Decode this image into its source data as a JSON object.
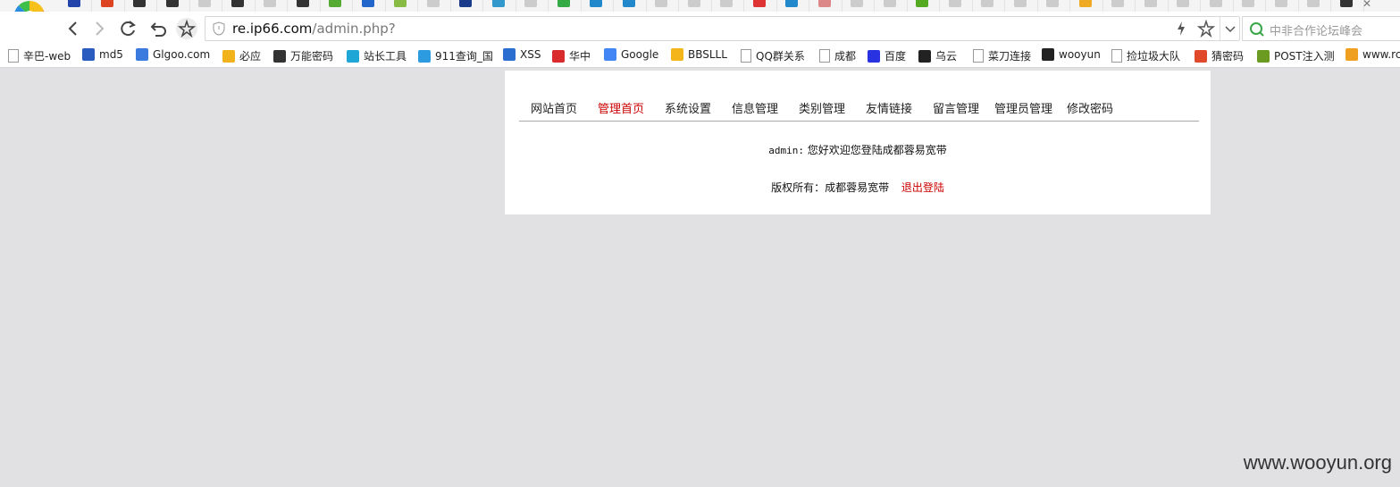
{
  "browser": {
    "url_host": "re.ip66.com",
    "url_path": "/admin.php?",
    "search_placeholder": "中非合作论坛峰会",
    "tab_icon_colors": [
      "#2244aa",
      "#dd4422",
      "#333333",
      "#333333",
      "#cccccc",
      "#333333",
      "#cccccc",
      "#333333",
      "#55aa33",
      "#2266cc",
      "#88bb44",
      "#cccccc",
      "#1a3a8a",
      "#3399cc",
      "#cccccc",
      "#33aa44",
      "#2288cc",
      "#2288cc",
      "#cccccc",
      "#cccccc",
      "#cccccc",
      "#dd3333",
      "#2288cc",
      "#dd8888",
      "#cccccc",
      "#cccccc",
      "#55aa22",
      "#cccccc",
      "#cccccc",
      "#cccccc",
      "#cccccc",
      "#eeaa22",
      "#cccccc",
      "#cccccc",
      "#cccccc",
      "#cccccc",
      "#cccccc",
      "#cccccc",
      "#cccccc",
      "#333333"
    ]
  },
  "bookmarks": [
    {
      "label": "辛巴-web",
      "icon": "page-icon",
      "color": "#ffffff"
    },
    {
      "label": "md5",
      "icon": "grid-icon",
      "color": "#2a5bbf"
    },
    {
      "label": "Glgoo.com",
      "icon": "search-icon",
      "color": "#3b7be0"
    },
    {
      "label": "必应",
      "icon": "bing-icon",
      "color": "#f2b21b"
    },
    {
      "label": "万能密码",
      "icon": "l-icon",
      "color": "#333333"
    },
    {
      "label": "站长工具",
      "icon": "chinaz-icon",
      "color": "#1ea6d6"
    },
    {
      "label": "911查询_国",
      "icon": "911-icon",
      "color": "#2d9be0"
    },
    {
      "label": "XSS",
      "icon": "xss-icon",
      "color": "#2a6fcf"
    },
    {
      "label": "华中",
      "icon": "cloud-icon",
      "color": "#d92b2b"
    },
    {
      "label": "Google",
      "icon": "google-icon",
      "color": "#4285f4"
    },
    {
      "label": "BBSLLL",
      "icon": "trophy-icon",
      "color": "#f3b51a"
    },
    {
      "label": "QQ群关系",
      "icon": "page-icon",
      "color": "#ffffff"
    },
    {
      "label": "成都",
      "icon": "page-icon",
      "color": "#ffffff"
    },
    {
      "label": "百度",
      "icon": "baidu-icon",
      "color": "#2932e1"
    },
    {
      "label": "乌云",
      "icon": "wooyun-icon",
      "color": "#222222"
    },
    {
      "label": "菜刀连接",
      "icon": "page-icon",
      "color": "#ffffff"
    },
    {
      "label": "wooyun",
      "icon": "wooyun-icon",
      "color": "#222222"
    },
    {
      "label": "捡垃圾大队",
      "icon": "star-icon",
      "color": "#ffffff"
    },
    {
      "label": "猜密码",
      "icon": "tiles-icon",
      "color": "#e04a2b"
    },
    {
      "label": "POST注入测",
      "icon": "f-icon",
      "color": "#6a9a1f"
    },
    {
      "label": "www.rc",
      "icon": "pma-icon",
      "color": "#f0a020"
    }
  ],
  "site": {
    "menu": [
      {
        "label": "网站首页",
        "active": false
      },
      {
        "label": "管理首页",
        "active": true
      },
      {
        "label": "系统设置",
        "active": false
      },
      {
        "label": "信息管理",
        "active": false
      },
      {
        "label": "类别管理",
        "active": false
      },
      {
        "label": "友情链接",
        "active": false
      },
      {
        "label": "留言管理",
        "active": false
      },
      {
        "label": "管理员管理",
        "active": false
      },
      {
        "label": "修改密码",
        "active": false
      }
    ],
    "welcome_user": "admin:",
    "welcome_text": "您好欢迎您登陆成都蓉易宽带",
    "copyright": "版权所有：成都蓉易宽带",
    "logout": "退出登陆",
    "accent_color": "#cc0000"
  },
  "watermark": "www.wooyun.org"
}
